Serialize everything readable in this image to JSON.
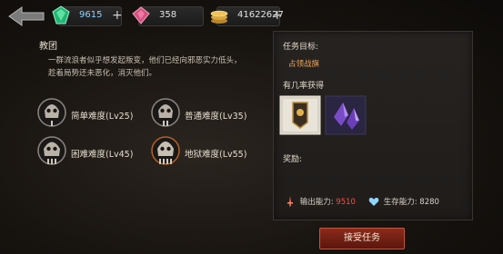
{
  "topbar": {
    "currencies": [
      {
        "icon": "green-gem-icon",
        "value": "9615"
      },
      {
        "icon": "pink-crystal-icon",
        "value": "358"
      },
      {
        "icon": "gold-coins-icon",
        "value": "41622627"
      }
    ]
  },
  "mission": {
    "title": "教团",
    "description_line1": "一群流浪者似乎想发起叛变，他们已经向邪恶实力低头，",
    "description_line2": "趁着局势还未恶化，消灭他们。",
    "difficulties": [
      {
        "label": "简单难度(Lv25)",
        "tier": "I"
      },
      {
        "label": "普通难度(Lv35)",
        "tier": "II"
      },
      {
        "label": "困难难度(Lv45)",
        "tier": "III"
      },
      {
        "label": "地狱难度(Lv55)",
        "tier": "IV"
      }
    ]
  },
  "details": {
    "objective_label": "任务目标:",
    "objective_value": "占领战旗",
    "drop_label": "有几率获得",
    "items": [
      "banner-token-icon",
      "purple-crystal-icon"
    ],
    "reward_label": "奖励:",
    "attack_label": "输出能力:",
    "attack_value": "9510",
    "survival_label": "生存能力:",
    "survival_value": "8280"
  },
  "accept_button": "接受任务",
  "colors": {
    "accent_red": "#ff4b3a",
    "objective_orange": "#f0a55a",
    "button": "#8b2a1c"
  }
}
